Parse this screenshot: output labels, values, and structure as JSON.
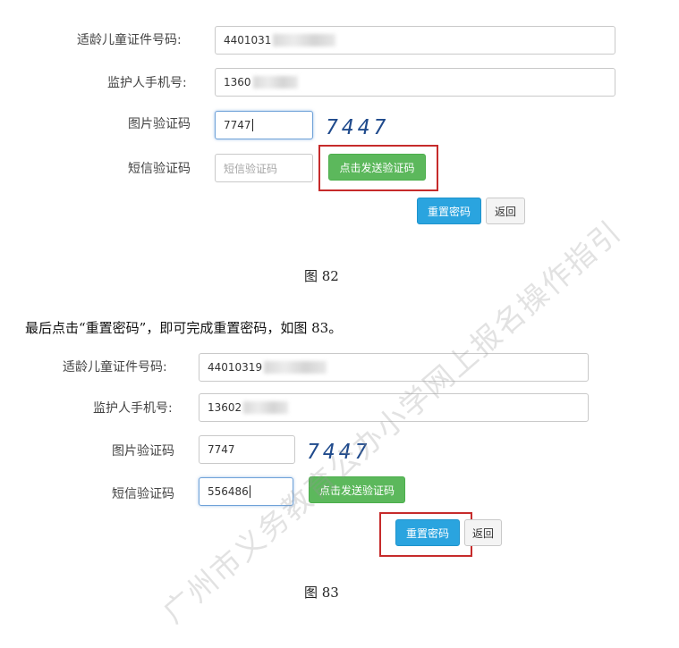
{
  "figure1": {
    "child_id_label": "适龄儿童证件号码:",
    "child_id_value": "4401031",
    "phone_label": "监护人手机号:",
    "phone_value": "1360",
    "captcha_label": "图片验证码",
    "captcha_input": "7747",
    "captcha_image_text": "7447",
    "sms_label": "短信验证码",
    "sms_placeholder": "短信验证码",
    "send_sms_button": "点击发送验证码",
    "reset_button": "重置密码",
    "back_button": "返回",
    "caption": "图 82"
  },
  "instruction": "最后点击“重置密码”，即可完成重置密码，如图 83。",
  "figure2": {
    "child_id_label": "适龄儿童证件号码:",
    "child_id_value": "44010319",
    "phone_label": "监护人手机号:",
    "phone_value": "13602",
    "captcha_label": "图片验证码",
    "captcha_input": "7747",
    "captcha_image_text": "7447",
    "sms_label": "短信验证码",
    "sms_value": "556486",
    "send_sms_button": "点击发送验证码",
    "reset_button": "重置密码",
    "back_button": "返回",
    "caption": "图 83"
  },
  "watermark": "广州市义务教育公办小学网上报名操作指引",
  "colors": {
    "green_button": "#5cb85c",
    "blue_button": "#2aa4df",
    "highlight_box": "#c62b2b",
    "captcha_text": "#1f4a8c"
  }
}
